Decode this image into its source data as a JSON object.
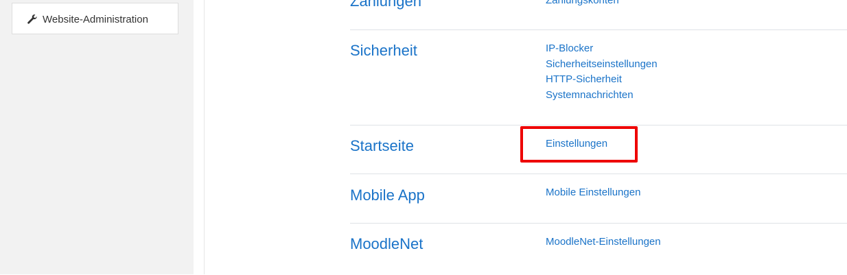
{
  "sidebar": {
    "item_label": "Website-Administration",
    "item_icon": "wrench-icon"
  },
  "sections": {
    "zahlungen": {
      "title": "Zahlungen",
      "links": [
        "Zahlungskonten"
      ]
    },
    "sicherheit": {
      "title": "Sicherheit",
      "links": [
        "IP-Blocker",
        "Sicherheitseinstellungen",
        "HTTP-Sicherheit",
        "Systemnachrichten"
      ]
    },
    "startseite": {
      "title": "Startseite",
      "links": [
        "Einstellungen"
      ]
    },
    "mobile_app": {
      "title": "Mobile App",
      "links": [
        "Mobile Einstellungen"
      ]
    },
    "moodlenet": {
      "title": "MoodleNet",
      "links": [
        "MoodleNet-Einstellungen"
      ]
    }
  },
  "colors": {
    "link": "#1a73c8",
    "highlight": "#ee0000",
    "sidebar_bg": "#f2f2f2"
  }
}
